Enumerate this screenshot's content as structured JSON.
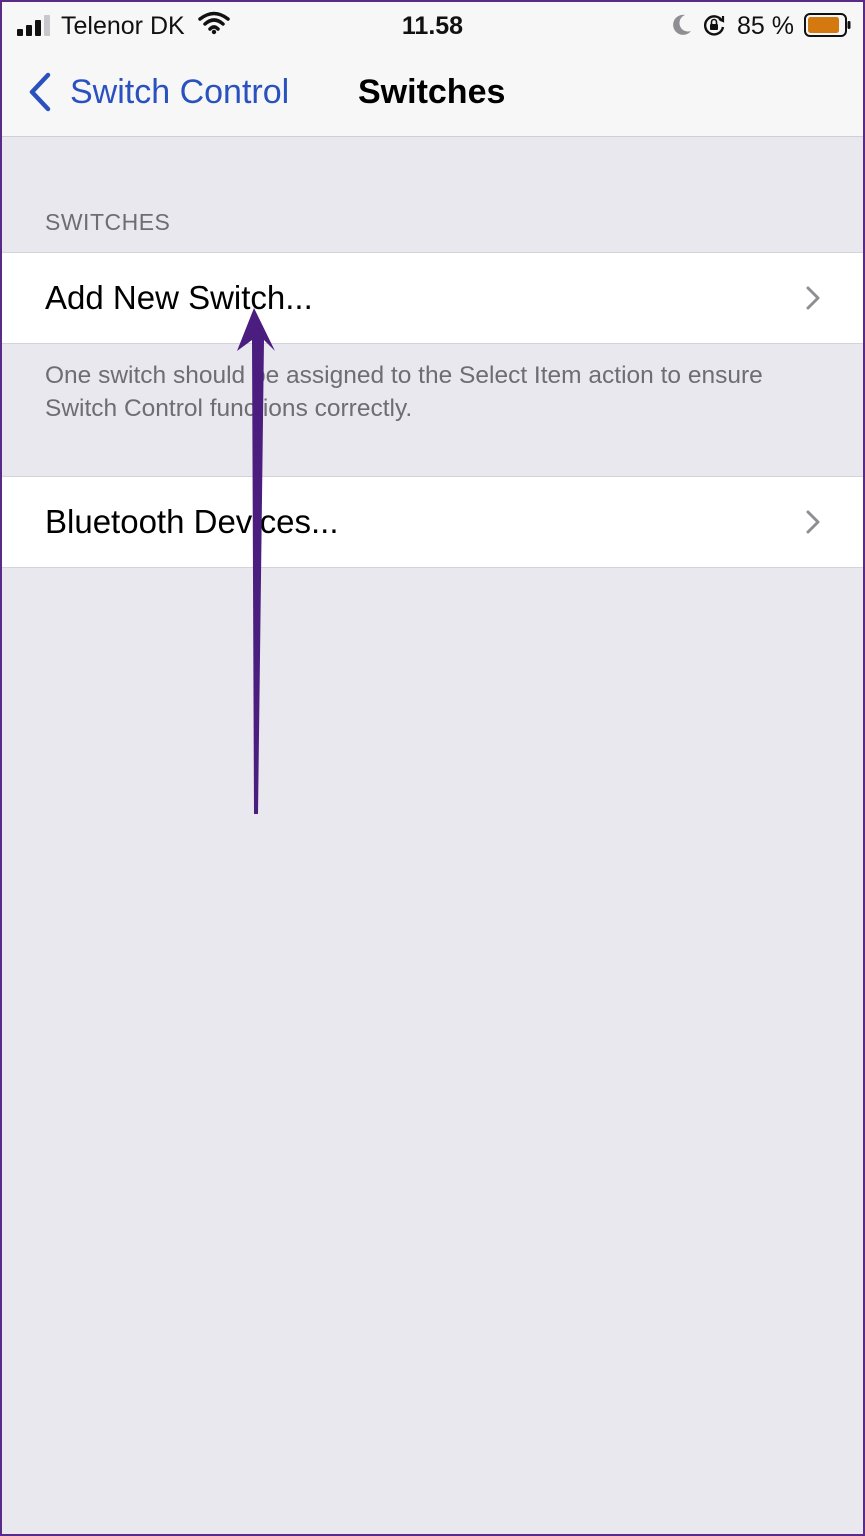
{
  "status_bar": {
    "carrier": "Telenor DK",
    "time": "11.58",
    "battery_percent": "85 %",
    "icons": [
      "signal-icon",
      "wifi-icon",
      "moon-icon",
      "orientation-lock-icon",
      "battery-icon"
    ]
  },
  "nav": {
    "back_label": "Switch Control",
    "title": "Switches"
  },
  "section": {
    "header": "SWITCHES",
    "footer": "One switch should be assigned to the Select Item action to ensure Switch Control functions correctly."
  },
  "rows": [
    {
      "label": "Add New Switch..."
    },
    {
      "label": "Bluetooth Devices..."
    }
  ],
  "colors": {
    "accent": "#2a52be",
    "annotation_arrow": "#4a1d7e",
    "battery_fill": "#d4790f",
    "background": "#e9e8ee"
  }
}
